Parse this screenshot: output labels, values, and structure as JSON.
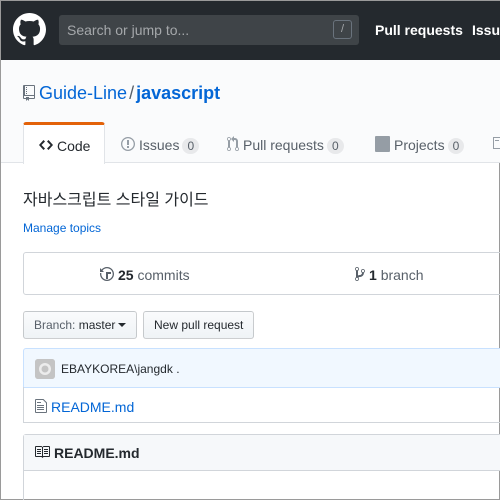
{
  "header": {
    "search_placeholder": "Search or jump to...",
    "search_key": "/",
    "nav_pull_requests": "Pull requests",
    "nav_issues": "Issues"
  },
  "repo": {
    "owner": "Guide-Line",
    "separator": "/",
    "name": "javascript"
  },
  "tabs": [
    {
      "label": "Code",
      "icon": "code-icon",
      "selected": true
    },
    {
      "label": "Issues",
      "count": "0",
      "icon": "issue-opened-icon"
    },
    {
      "label": "Pull requests",
      "count": "0",
      "icon": "git-pull-request-icon"
    },
    {
      "label": "Projects",
      "count": "0",
      "icon": "project-icon"
    }
  ],
  "description": "자바스크립트 스타일 가이드",
  "manage_topics": "Manage topics",
  "summary": {
    "commits_count": "25",
    "commits_label": "commits",
    "branch_count": "1",
    "branch_label": "branch"
  },
  "branch_button": {
    "label": "Branch:",
    "value": "master"
  },
  "new_pr_button": "New pull request",
  "commit": {
    "author": "EBAYKOREA\\jangdk",
    "message": "."
  },
  "files": [
    {
      "name": "README.md",
      "icon": "file-icon"
    }
  ],
  "readme": {
    "title": "README.md",
    "icon": "book-icon"
  },
  "colors": {
    "header_bg": "#24292e",
    "link": "#0366d6",
    "tab_accent": "#e36209",
    "commit_bg": "#f1f8ff"
  }
}
